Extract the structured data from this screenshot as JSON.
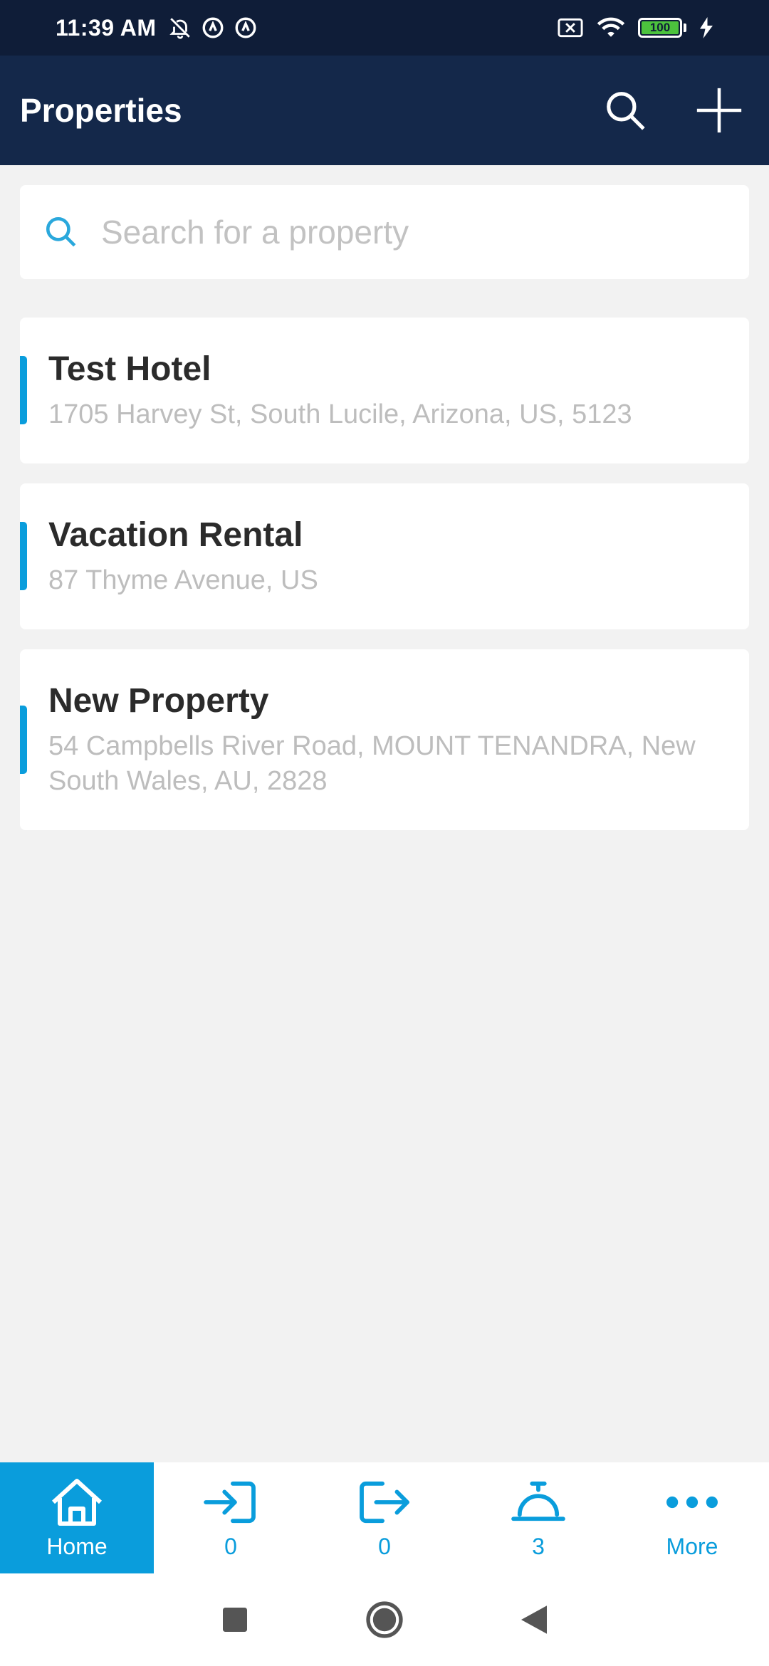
{
  "status_bar": {
    "time": "11:39 AM",
    "battery_level": "100"
  },
  "app_bar": {
    "title": "Properties",
    "search_icon": "search-icon",
    "add_icon": "plus-icon"
  },
  "search": {
    "placeholder": "Search for a property",
    "value": ""
  },
  "properties": [
    {
      "name": "Test Hotel",
      "address": "1705 Harvey St, South Lucile, Arizona, US, 5123"
    },
    {
      "name": "Vacation Rental",
      "address": "87 Thyme Avenue, US"
    },
    {
      "name": "New Property",
      "address": "54 Campbells River Road, MOUNT TENANDRA, New South Wales, AU, 2828"
    }
  ],
  "bottom_nav": {
    "items": [
      {
        "label": "Home",
        "icon": "home-icon",
        "active": true
      },
      {
        "label": "0",
        "icon": "check-in-icon",
        "active": false
      },
      {
        "label": "0",
        "icon": "check-out-icon",
        "active": false
      },
      {
        "label": "3",
        "icon": "service-bell-icon",
        "active": false
      },
      {
        "label": "More",
        "icon": "more-dots-icon",
        "active": false
      }
    ]
  },
  "colors": {
    "status_bar_bg": "#0f1d38",
    "app_bar_bg": "#14284a",
    "accent": "#0a9ddc",
    "background": "#f2f2f2"
  }
}
